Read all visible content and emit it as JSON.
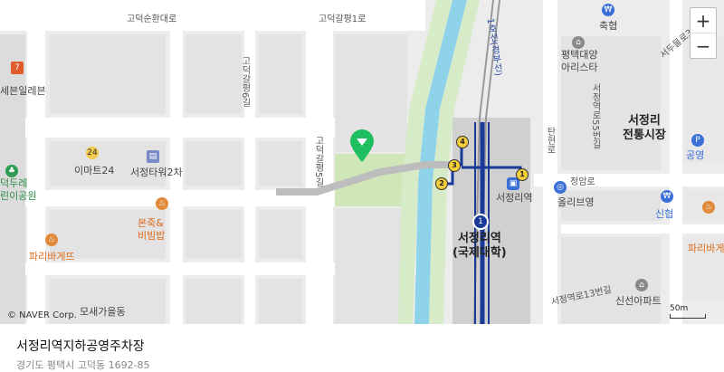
{
  "map": {
    "roads": {
      "godeoksunhwan": "고덕순환대로",
      "godeokgal1": "고덕갈평1로",
      "godeokgal6": "고덕갈평6길",
      "godeokgal2": "고덕갈평2로",
      "godeokgal5": "고덕갈평5길",
      "line1": "1호선(경부선)",
      "seojeong55": "서정역로55번길",
      "sincheon": "탄현로",
      "jeongam": "정암로",
      "seojeong13": "서정역로13번길",
      "sadong": "서두물로31번길"
    },
    "pois": {
      "seven": "세븐일레븐",
      "emart24": "이마트24",
      "emart24_badge": "24",
      "seojeong_tower": "서정타워2차",
      "bonjuk": "본죽&\n비빔밥",
      "paris_left": "파리바게뜨",
      "dukdure": "덕두레\n린이공원",
      "mosae": "모새가을동",
      "chukhyup": "축협",
      "apt": "평택대양\n아리스타",
      "market": "서정리\n전통시장",
      "gongyeong": "공영",
      "olive": "올리브영",
      "sinhyup": "신협",
      "paris_right": "파리바게뜨",
      "sinseon_apt": "신선아파트",
      "station_small": "서정리역",
      "station_main": "서정리역\n(국제대학)",
      "line_number": "1"
    },
    "exits": [
      "1",
      "2",
      "3",
      "4"
    ],
    "zoom": {
      "in": "+",
      "out": "−"
    },
    "copyright": "© NAVER Corp.",
    "scale": "50m"
  },
  "place": {
    "title": "서정리역지하공영주차장",
    "address": "경기도 평택시 고덕동 1692-85"
  },
  "colors": {
    "line1": "#1a3a9a",
    "stream": "#8fd3ea",
    "park": "#cfe6b8",
    "marker": "#1fbf5f"
  }
}
